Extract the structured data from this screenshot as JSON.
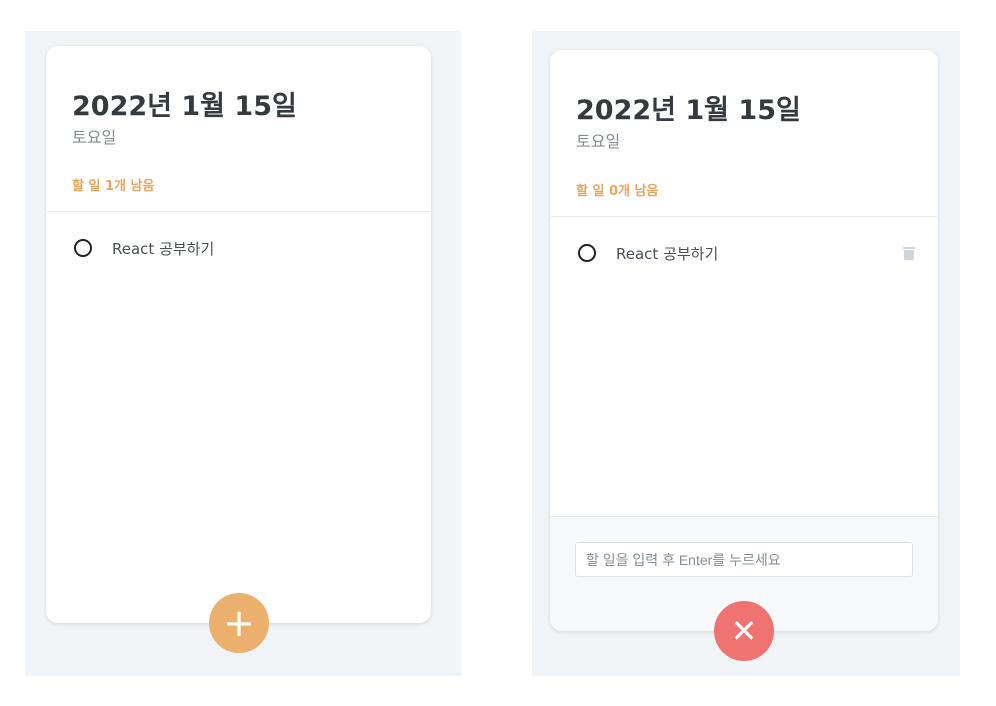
{
  "left": {
    "date": "2022년 1월 15일",
    "day": "토요일",
    "remaining": "할 일 1개 남음",
    "todos": [
      {
        "text": "React 공부하기",
        "done": false
      }
    ],
    "fab": "+"
  },
  "right": {
    "date": "2022년 1월 15일",
    "day": "토요일",
    "remaining": "할 일 0개 남음",
    "todos": [
      {
        "text": "React 공부하기",
        "done": false
      }
    ],
    "input_placeholder": "할 일을 입력 후 Enter를 누르세요",
    "input_value": "",
    "fab": "✕"
  },
  "colors": {
    "accent": "#e9a65f",
    "add": "#ebb06d",
    "close": "#ee7371"
  }
}
